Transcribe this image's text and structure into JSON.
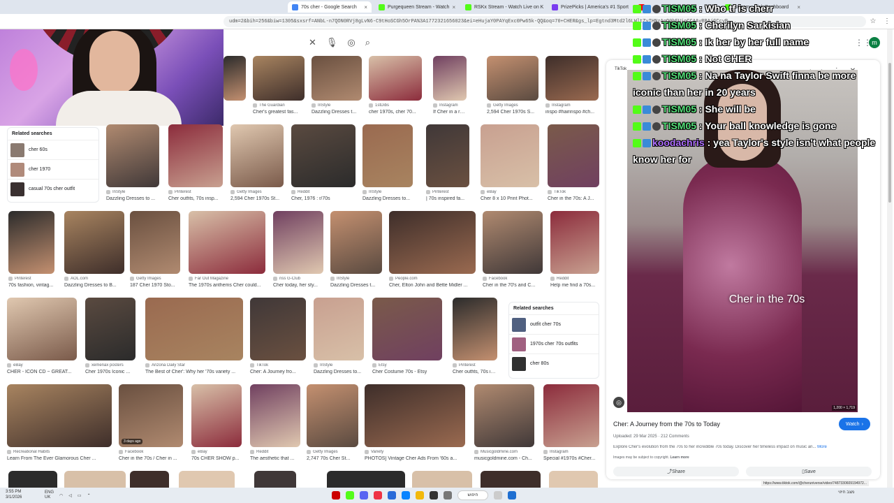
{
  "browser": {
    "tabs": [
      {
        "label": "70s cher - Google Search",
        "active": true
      },
      {
        "label": "Purgequeen Stream - Watch",
        "active": false
      },
      {
        "label": "RSKx Stream - Watch Live on K",
        "active": false
      },
      {
        "label": "PrizePicks | America's #1 Sport",
        "active": false
      },
      {
        "label": "",
        "active": false
      },
      {
        "label": "Stream - Kick Dashboard",
        "active": false
      }
    ],
    "url": "udm=2&bih=256&biw=1305&sxsrf=ANbL-n7QON0RVj8gLvN6-C9tHoSCGh5OrPA%3A1772321656023&ei=eHujaY0PAYqExc0Pw65k-QQ&oq=70+CHER&gs_lp=Egtnd3Mtd2l6LWltZyIHNzAgQ0hFUioCCAAyBBAjGCcyB...",
    "avatar_letter": "m"
  },
  "chat": [
    {
      "user": "TISM05",
      "msg": "Who tf is cherr",
      "badges": 3
    },
    {
      "user": "TISM05",
      "msg": "Cherilyn Sarkisian",
      "badges": 3
    },
    {
      "user": "TISM05",
      "msg": "Ik her by her full name",
      "badges": 3
    },
    {
      "user": "TISM05",
      "msg": "Not CHER",
      "badges": 3
    },
    {
      "user": "TISM05",
      "msg": "Na na Taylor Swift finna be more iconic than her in 20 years",
      "badges": 3
    },
    {
      "user": "TISM05",
      "msg": "She will be",
      "badges": 3
    },
    {
      "user": "TISM05",
      "msg": "Your ball knowledge is gone",
      "badges": 3
    },
    {
      "user": "koodachris",
      "msg": "yea Taylor's style isn't what people know her for",
      "badges": 2
    }
  ],
  "related_left": {
    "heading": "Related searches",
    "items": [
      {
        "label": "cher 60s"
      },
      {
        "label": "cher 1970"
      },
      {
        "label": "casual 70s cher outfit"
      }
    ]
  },
  "related_mid": {
    "heading": "Related searches",
    "items": [
      {
        "label": "outfit cher 70s"
      },
      {
        "label": "1970s cher 70s outfits"
      },
      {
        "label": "cher 80s"
      }
    ]
  },
  "grid": {
    "row0": [
      {
        "src": "The Guardian",
        "cap": "Cher's greatest fas..."
      },
      {
        "src": "InStyle",
        "cap": "Dazzling Dresses t..."
      },
      {
        "src": "1stDibs",
        "cap": "cher 1970s, cher 70..."
      },
      {
        "src": "Instagram",
        "cap": "If Cher in a rainbo..."
      },
      {
        "src": "Getty Images",
        "cap": "2,594 Cher 1970s S..."
      },
      {
        "src": "Instagram",
        "cap": "inspo #hairinspo #ch..."
      }
    ],
    "row1": [
      {
        "src": "InStyle",
        "cap": "Dazzling Dresses to ..."
      },
      {
        "src": "Pinterest",
        "cap": "Cher outfits, 70s insp..."
      },
      {
        "src": "Getty Images",
        "cap": "2,594 Cher 1970s St..."
      },
      {
        "src": "Reddit",
        "cap": "Cher, 1976 : r/70s"
      },
      {
        "src": "InStyle",
        "cap": "Dazzling Dresses to..."
      },
      {
        "src": "Pinterest",
        "cap": "| 70s inspired fa..."
      },
      {
        "src": "eBay",
        "cap": "Cher 8 x 10 Print Phot..."
      },
      {
        "src": "TikTok",
        "cap": "Cher in the 70s: A J..."
      }
    ],
    "row2": [
      {
        "src": "Pinterest",
        "cap": "70s fashion, vintag..."
      },
      {
        "src": "AOL.com",
        "cap": "Dazzling Dresses to B..."
      },
      {
        "src": "Getty Images",
        "cap": "187 Cher 1970 Sto..."
      },
      {
        "src": "Far Out Magazine",
        "cap": "The 1970s anthems Cher could..."
      },
      {
        "src": "nss G-Club",
        "cap": "Cher today, her sty..."
      },
      {
        "src": "InStyle",
        "cap": "Dazzling Dresses t..."
      },
      {
        "src": "People.com",
        "cap": "Cher, Elton John and Bette Midler ..."
      },
      {
        "src": "Facebook",
        "cap": "Cher in the 70's and C..."
      },
      {
        "src": "Reddit",
        "cap": "Help me find a 70s..."
      }
    ],
    "row3": [
      {
        "src": "eBay",
        "cap": "CHER - ICON CD ~ GREAT..."
      },
      {
        "src": "xemenax posters",
        "cap": "Cher 1970s Iconic ..."
      },
      {
        "src": "Arizona Daily Star",
        "cap": "The Best of Cher': Why her '70s variety ..."
      },
      {
        "src": "TikTok",
        "cap": "Cher: A Journey fro..."
      },
      {
        "src": "InStyle",
        "cap": "Dazzling Dresses to..."
      },
      {
        "src": "Etsy",
        "cap": "Cher Costume 70s - Etsy"
      },
      {
        "src": "Pinterest",
        "cap": "Cher outfits, 70s in..."
      }
    ],
    "row4": [
      {
        "src": "Recreational Habits",
        "cap": "Learn From The Ever Glamorous Cher ..."
      },
      {
        "src": "Facebook",
        "cap": "Cher in the 70s / Cher in ...",
        "badge": "3 days ago"
      },
      {
        "src": "eBay",
        "cap": "70s CHER SHOW p..."
      },
      {
        "src": "Reddit",
        "cap": "The aesthetic that ..."
      },
      {
        "src": "Getty Images",
        "cap": "2,747 70s Cher St..."
      },
      {
        "src": "Variety",
        "cap": "PHOTOS] Vintage Cher Ads From '60s a..."
      },
      {
        "src": "Musicgoldmine.com",
        "cap": "musicgoldmine.com - Ch..."
      },
      {
        "src": "Instagram",
        "cap": "Special #1970s #Cher..."
      }
    ]
  },
  "panel": {
    "source": "TikTok",
    "overlay": "Cher in the 70s",
    "size_badge": "1,200 × 1,719",
    "title": "Cher: A Journey from the 70s to Today",
    "watch": "Watch",
    "meta": "Uploaded: 29 Mar 2025 · 212 Comments",
    "desc": "Explore Cher's evolution from the 70s to her incredible 70s today. Discover her timeless impact on music an...",
    "more": "More",
    "copyright": "Images may be subject to copyright.",
    "learn_more": "Learn more",
    "share": "Share",
    "save": "Save"
  },
  "status_url": "https://www.tiktok.com/@cheruniverse/video/7487330609194972...",
  "taskbar": {
    "clock_time": "3:55 PM",
    "clock_date": "3/1/2026",
    "lang": "ENG",
    "region": "UK",
    "search_text": "חיפוש",
    "weather": "מצב חיזוי"
  }
}
